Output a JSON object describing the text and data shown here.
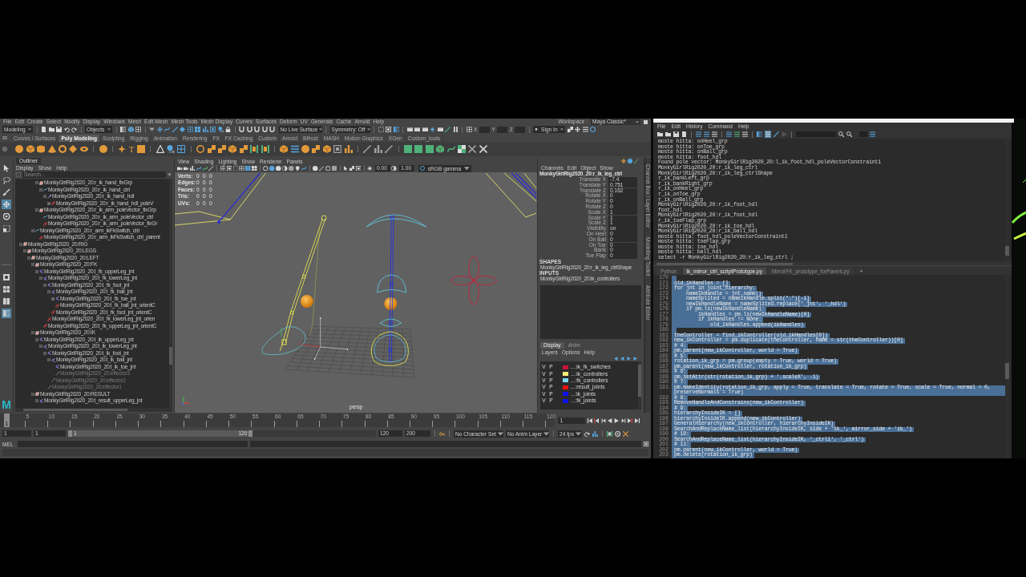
{
  "maya": {
    "menu_bar": {
      "items": [
        "File",
        "Edit",
        "Create",
        "Select",
        "Modify",
        "Display",
        "Windows",
        "Mesh",
        "Edit Mesh",
        "Mesh Tools",
        "Mesh Display",
        "Curves",
        "Surfaces",
        "Deform",
        "UV",
        "Generate",
        "Cache",
        "Arnold",
        "Help"
      ],
      "workspace_label": "Workspace :",
      "workspace": "Maya Classic*"
    },
    "status_line": {
      "menu_set": "Modeling",
      "selection_mode": "Objects",
      "live_surface": "No Live Surface",
      "symmetry": "Symmetry: Off",
      "axis_labels": [
        "X",
        "Y",
        "Z"
      ],
      "sign_in": "Sign In"
    },
    "shelf": {
      "tabs": [
        {
          "label": "Curves / Surfaces",
          "selected": false
        },
        {
          "label": "Poly Modeling",
          "selected": true
        },
        {
          "label": "Sculpting",
          "selected": false
        },
        {
          "label": "Rigging",
          "selected": false
        },
        {
          "label": "Animation",
          "selected": false
        },
        {
          "label": "Rendering",
          "selected": false
        },
        {
          "label": "FX",
          "selected": false
        },
        {
          "label": "FX Caching",
          "selected": false
        },
        {
          "label": "Custom",
          "selected": false
        },
        {
          "label": "Arnold",
          "selected": false
        },
        {
          "label": "Bifrost",
          "selected": false
        },
        {
          "label": "MASH",
          "selected": false
        },
        {
          "label": "Motion Graphics",
          "selected": false
        },
        {
          "label": "XGen",
          "selected": false
        },
        {
          "label": "Custom_tools",
          "selected": false
        }
      ],
      "type_tool": "T"
    },
    "toolbox": {
      "tools": [
        {
          "selected": false
        },
        {
          "selected": false
        },
        {
          "selected": false
        },
        {
          "selected": true
        },
        {
          "selected": false
        },
        {
          "selected": false
        }
      ],
      "layouts": [
        {
          "selected": false
        },
        {
          "selected": false
        },
        {
          "selected": false
        },
        {
          "selected": true
        }
      ],
      "logo": "M"
    },
    "outliner": {
      "title": "Outliner",
      "menu": [
        "Display",
        "Show",
        "Help"
      ],
      "search_placeholder": "Search...",
      "tree_scrolled_part": {
        "inner": [
          {
            "label": "MonkyGirlRig2020_20:r_ik_hand_fixGrp",
            "kind": "group",
            "expanded": true,
            "hidden": false,
            "children": [
              {
                "label": "MonkyGirlRig2020_20:r_ik_hand_ctrl",
                "kind": "curve",
                "expanded": true,
                "hidden": false,
                "children": [
                  {
                    "label": "MonkyGirlRig2020_20:r_ik_hand_hdl",
                    "kind": "ikHandle",
                    "expanded": true,
                    "hidden": false,
                    "children": [
                      {
                        "label": "MonkyGirlRig2020_20:r_ik_hand_hdl_poleV",
                        "kind": "constraint",
                        "expanded": false,
                        "hidden": false
                      }
                    ]
                  }
                ]
              }
            ]
          },
          {
            "label": "MonkyGirlRig2020_20:r_ik_arm_poleVector_fixGrp",
            "kind": "group",
            "expanded": true,
            "hidden": false,
            "children": [
              {
                "label": "MonkyGirlRig2020_20:r_ik_arm_poleVector_ctrl",
                "kind": "curve",
                "hidden": false
              },
              {
                "label": "MonkyGirlRig2020_20:r_ik_arm_poleVector_fixGr",
                "kind": "constraint",
                "hidden": false
              }
            ]
          }
        ],
        "outer": [
          {
            "label": "MonkyGirlRig2020_20:r_arm_ikFkSwitch_ctrl",
            "kind": "curve",
            "expanded": true,
            "hidden": false,
            "children": [
              {
                "label": "MonkyGirlRig2020_20:r_arm_ikFkSwitch_ctrl_parent",
                "kind": "constraint",
                "hidden": false
              }
            ]
          }
        ]
      },
      "tree": [
        {
          "label": "MonkyGirlRig2020_20:RIG",
          "kind": "group",
          "expanded": true,
          "hidden": false,
          "children": [
            {
              "label": "MonkyGirlRig2020_20:LEGS",
              "kind": "group",
              "expanded": true,
              "hidden": false,
              "children": [
                {
                  "label": "MonkyGirlRig2020_20:LEFT",
                  "kind": "group",
                  "expanded": true,
                  "hidden": false,
                  "children": [
                    {
                      "label": "MonkyGirlRig2020_20:FK",
                      "kind": "group",
                      "expanded": true,
                      "hidden": false,
                      "children": [
                        {
                          "label": "MonkyGirlRig2020_20:l_fk_upperLeg_jnt",
                          "kind": "joint",
                          "expanded": true,
                          "hidden": false,
                          "children": [
                            {
                              "label": "MonkyGirlRig2020_20:l_fk_lowerLeg_jnt",
                              "kind": "joint",
                              "expanded": true,
                              "hidden": false,
                              "children": [
                                {
                                  "label": "MonkyGirlRig2020_20:l_fk_foot_jnt",
                                  "kind": "joint",
                                  "expanded": true,
                                  "hidden": false,
                                  "children": [
                                    {
                                      "label": "MonkyGirlRig2020_20:l_fk_ball_jnt",
                                      "kind": "joint",
                                      "expanded": true,
                                      "hidden": false,
                                      "children": [
                                        {
                                          "label": "MonkyGirlRig2020_20:l_fk_toe_jnt",
                                          "kind": "joint",
                                          "expanded": false,
                                          "hidden": false
                                        },
                                        {
                                          "label": "MonkyGirlRig2020_20:l_fk_ball_jnt_orientC",
                                          "kind": "constraint",
                                          "hidden": false
                                        }
                                      ]
                                    },
                                    {
                                      "label": "MonkyGirlRig2020_20:l_fk_foot_jnt_orientC",
                                      "kind": "constraint",
                                      "hidden": false
                                    }
                                  ]
                                },
                                {
                                  "label": "MonkyGirlRig2020_20:l_fk_lowerLeg_jnt_orien",
                                  "kind": "constraint",
                                  "hidden": false
                                }
                              ]
                            },
                            {
                              "label": "MonkyGirlRig2020_20:l_fk_upperLeg_jnt_orientC",
                              "kind": "constraint",
                              "hidden": false
                            }
                          ]
                        }
                      ]
                    },
                    {
                      "label": "MonkyGirlRig2020_20:IK",
                      "kind": "group",
                      "expanded": true,
                      "hidden": false,
                      "children": [
                        {
                          "label": "MonkyGirlRig2020_20:l_ik_upperLeg_jnt",
                          "kind": "joint",
                          "expanded": true,
                          "hidden": false,
                          "children": [
                            {
                              "label": "MonkyGirlRig2020_20:l_ik_lowerLeg_jnt",
                              "kind": "joint",
                              "expanded": true,
                              "hidden": false,
                              "children": [
                                {
                                  "label": "MonkyGirlRig2020_20:l_ik_foot_jnt",
                                  "kind": "joint",
                                  "expanded": true,
                                  "hidden": false,
                                  "children": [
                                    {
                                      "label": "MonkyGirlRig2020_20:l_ik_ball_jnt",
                                      "kind": "joint",
                                      "expanded": true,
                                      "hidden": false,
                                      "children": [
                                        {
                                          "label": "MonkyGirlRig2020_20:l_ik_toe_jnt",
                                          "kind": "joint",
                                          "hidden": false
                                        },
                                        {
                                          "label": "MonkyGirlRig2020_20:effector3",
                                          "kind": "effector",
                                          "hidden": true
                                        }
                                      ]
                                    },
                                    {
                                      "label": "MonkyGirlRig2020_20:effector2",
                                      "kind": "effector",
                                      "hidden": true
                                    }
                                  ]
                                },
                                {
                                  "label": "MonkyGirlRig2020_20:effector1",
                                  "kind": "effector",
                                  "hidden": true
                                }
                              ]
                            }
                          ]
                        }
                      ]
                    },
                    {
                      "label": "MonkyGirlRig2020_20:RESULT",
                      "kind": "group",
                      "expanded": true,
                      "hidden": false,
                      "children": [
                        {
                          "label": "MonkyGirlRig2020_20:l_result_upperLeg_jnt",
                          "kind": "joint",
                          "expanded": true,
                          "hidden": false
                        }
                      ]
                    }
                  ]
                }
              ]
            }
          ]
        }
      ]
    },
    "viewport": {
      "menu": [
        "View",
        "Shading",
        "Lighting",
        "Show",
        "Renderer",
        "Panels"
      ],
      "exposure": "0.00",
      "gamma": "1.00",
      "color_space": "sRGB gamma",
      "hud": [
        {
          "label": "Verts:",
          "values": [
            "0",
            "0",
            "0"
          ]
        },
        {
          "label": "Edges:",
          "values": [
            "0",
            "0",
            "0"
          ]
        },
        {
          "label": "Faces:",
          "values": [
            "0",
            "0",
            "0"
          ]
        },
        {
          "label": "Tris:",
          "values": [
            "0",
            "0",
            "0"
          ]
        },
        {
          "label": "UVs:",
          "values": [
            "0",
            "0",
            "0"
          ]
        }
      ],
      "camera": "persp"
    },
    "channel_box": {
      "menu": [
        "Channels",
        "Edit",
        "Object",
        "Show"
      ],
      "object": "MonkyGirlRig2020_20:r_ik_leg_ctrl",
      "channels": [
        {
          "name": "Translate X",
          "value": "-7.4"
        },
        {
          "name": "Translate Y",
          "value": "0.751"
        },
        {
          "name": "Translate Z",
          "value": "0.162"
        },
        {
          "name": "Rotate X",
          "value": "0"
        },
        {
          "name": "Rotate Y",
          "value": "0"
        },
        {
          "name": "Rotate Z",
          "value": "0"
        },
        {
          "name": "Scale X",
          "value": "1"
        },
        {
          "name": "Scale Y",
          "value": "1"
        },
        {
          "name": "Scale Z",
          "value": "1"
        },
        {
          "name": "Visibility",
          "value": "on"
        },
        {
          "name": "On Heel",
          "value": "0"
        },
        {
          "name": "On Ball",
          "value": "0"
        },
        {
          "name": "On Toe",
          "value": "0"
        },
        {
          "name": "Bank",
          "value": "0"
        },
        {
          "name": "Toe Flap",
          "value": "0"
        }
      ],
      "shapes_heading": "SHAPES",
      "shapes": [
        "MonkyGirlRig2020_20:r_ik_leg_ctrlShape"
      ],
      "inputs_heading": "INPUTS",
      "inputs": [
        "MonkyGirlRig2020_20:ik_controllers"
      ]
    },
    "layer_editor": {
      "tabs": [
        {
          "label": "Display",
          "selected": true
        },
        {
          "label": "Anim",
          "selected": false
        }
      ],
      "menu": [
        "Layers",
        "Options",
        "Help"
      ],
      "layers": [
        {
          "visible": "V",
          "playback": "P",
          "name": "...:ik_fk_switches",
          "color": "#c8143c"
        },
        {
          "visible": "V",
          "playback": "P",
          "name": "...:ik_controllers",
          "color": "#f2ee7a"
        },
        {
          "visible": "V",
          "playback": "P",
          "name": "...:fk_controllers",
          "color": "#78d8f0"
        },
        {
          "visible": "V",
          "playback": "P",
          "name": "...:result_joints",
          "color": "#e81010"
        },
        {
          "visible": "V",
          "playback": "P",
          "name": "...:ik_joints",
          "color": "#1010e8"
        },
        {
          "visible": "V",
          "playback": "P",
          "name": "...:fk_joints",
          "color": "#1010e8"
        }
      ]
    },
    "side_tabs": [
      "Channel Box / Layer Editor",
      "Modelling Toolkit",
      "Attribute Editor"
    ],
    "time_slider": {
      "marker_label": "1",
      "level": 0,
      "frames": [
        "5",
        "10",
        "15",
        "20",
        "25",
        "30",
        "35",
        "40",
        "45",
        "50",
        "55",
        "60",
        "65",
        "70",
        "75",
        "80",
        "85",
        "90",
        "95",
        "100",
        "105",
        "110",
        "115",
        "120"
      ],
      "current_frame": "1"
    },
    "range_slider": {
      "start": "1",
      "range_start": "1",
      "range_start_label": "1",
      "range_end": "120",
      "level": 0.6,
      "end": "120",
      "anim_end": "200",
      "character_set": "No Character Set",
      "anim_layer": "No Anim Layer",
      "fps": "24 fps"
    },
    "command_line": {
      "language": "MEL"
    }
  },
  "script_editor": {
    "menu": [
      "File",
      "Edit",
      "History",
      "Command",
      "Help"
    ],
    "output": [
      "moste hitta: onHeel_grp",
      "moste hitta: onToe_grp",
      "moste hitta: onBall_grp",
      "moste hitta: foot_hdl",
      "Found pole vector: MonkyGirlRig2020_20:l_ik_foot_hdl_poleVectorConstraint1",
      "MonkyGirlRig2020_20:r_ik_leg_ctrl",
      "MonkyGirlRig2020_20:r_ik_leg_ctrlShape",
      "r_ik_bankLeft_grp",
      "r_ik_bankRight_grp",
      "r_ik_onHeel_grp",
      "r_ik_onToe_grp",
      "r_ik_onBall_grp",
      "MonkyGirlRig2020_20:r_ik_foot_hdl",
      "foot_hdl",
      "MonkyGirlRig2020_20:r_ik_foot_hdl",
      "r_ik_toeFlap_grp",
      "MonkyGirlRig2020_20:r_ik_toe_hdl",
      "MonkyGirlRig2020_20:r_ik_ball_hdl",
      "moste hitta: foot_hdl_poleVectorConstraint1",
      "moste hitta: toeFlap_grp",
      "moste hitta: toe_hdl",
      "moste hitta: ball_hdl",
      "select -r MonkyGirlRig2020_20:r_ik_leg_ctrl ;"
    ],
    "tabs": [
      {
        "label": "Python",
        "selected": false
      },
      {
        "label": "ik_mirror_ctrl_scriptPrototype.py",
        "selected": true
      },
      {
        "label": "MirrorFK_prototype_forParent.py",
        "selected": false
      }
    ],
    "new_tab": "+",
    "code": [
      {
        "number": "170",
        "selected": true
      },
      {
        "number": "171",
        "text": "old_ikHandles = []",
        "selected": true
      },
      {
        "number": "172",
        "text": "for jnt in joint_hierarchy:",
        "selected": true
      },
      {
        "number": "173",
        "text": "    nameIkHandle = jnt.name()",
        "selected": true
      },
      {
        "number": "174",
        "text": "    nameSplited = nameIkHandle.split(\":\")[-1]",
        "selected": true
      },
      {
        "number": "175",
        "text": "    newIkHandleName = nameSplited.replace('_jnt', '_hdl')",
        "selected": true
      },
      {
        "number": "176",
        "text": "    if pm.ls(newIkHandleName):",
        "selected": true
      },
      {
        "number": "177",
        "text": "        ikHandles = pm.ls(newIkHandleName)[0]",
        "selected": true
      },
      {
        "number": "178",
        "text": "        if ikHandles != None:",
        "selected": true
      },
      {
        "number": "179",
        "text": "            old_ikHandles.append(ikHandles)",
        "selected": true
      },
      {
        "number": "180",
        "selected": true
      },
      {
        "number": "181",
        "text": "theController = find_ikController(old_ikHandles[0])",
        "selected": true
      },
      {
        "number": "182",
        "text": "new_ikController = pm.duplicate(theController, name = str(theController))[0]",
        "selected": true
      },
      {
        "number": "183",
        "text": "# 4:",
        "selected": true
      },
      {
        "number": "184",
        "text": "pm.parent(new_ikController, world = True)",
        "selected": true
      },
      {
        "number": "185",
        "text": "# 5:",
        "selected": true
      },
      {
        "number": "186",
        "text": "rotation_ik_grp = pm.group(empty = True, world = True)",
        "selected": true
      },
      {
        "number": "187",
        "text": "pm.parent(new_ikController, rotation_ik_grp)",
        "selected": true
      },
      {
        "number": "188",
        "text": "# 6:",
        "selected": true
      },
      {
        "number": "189",
        "text": "pm.setAttr(str(rotation_ik_grp) + '.scaleX', -1)",
        "selected": true
      },
      {
        "number": "190",
        "text": "# 7:",
        "selected": true
      },
      {
        "number": "191",
        "text": "pm.makeIdentity(rotation_ik_grp, apply = True, translate = True, rotate = True, scale = True, normal = 0, preserveNormals = True)",
        "selected": true
      },
      {
        "number": "192",
        "text": "# 8:",
        "selected": true
      },
      {
        "number": "193",
        "text": "RemoveHandleAndConstrains(new_ikController)",
        "selected": true
      },
      {
        "number": "194",
        "text": "# 9:",
        "selected": true
      },
      {
        "number": "195",
        "text": "hierarchyInsideIK = []",
        "selected": true
      },
      {
        "number": "196",
        "text": "hierarchyInsideIK.append(new_ikController)",
        "selected": true
      },
      {
        "number": "197",
        "text": "GeneralHierarchy(new_ikController, hierarchyInsideIK)",
        "selected": true
      },
      {
        "number": "198",
        "text": "SearchAndReplaceName_list(hierarchyInsideIK, side + 'ik_', mirror_side + 'ik_')",
        "selected": true
      },
      {
        "number": "199",
        "text": "# 10:",
        "selected": true
      },
      {
        "number": "200",
        "text": "SearchAndReplaceName_list(hierarchyInsideIK, '_ctrl1', '_ctrl')",
        "selected": true
      },
      {
        "number": "201",
        "text": "# 11:",
        "selected": true
      },
      {
        "number": "202",
        "text": "pm.parent(new_ikController, world = True)",
        "selected": true
      },
      {
        "number": "203",
        "text": "pm.delete(rotation_ik_grp)",
        "selected": true
      }
    ]
  }
}
